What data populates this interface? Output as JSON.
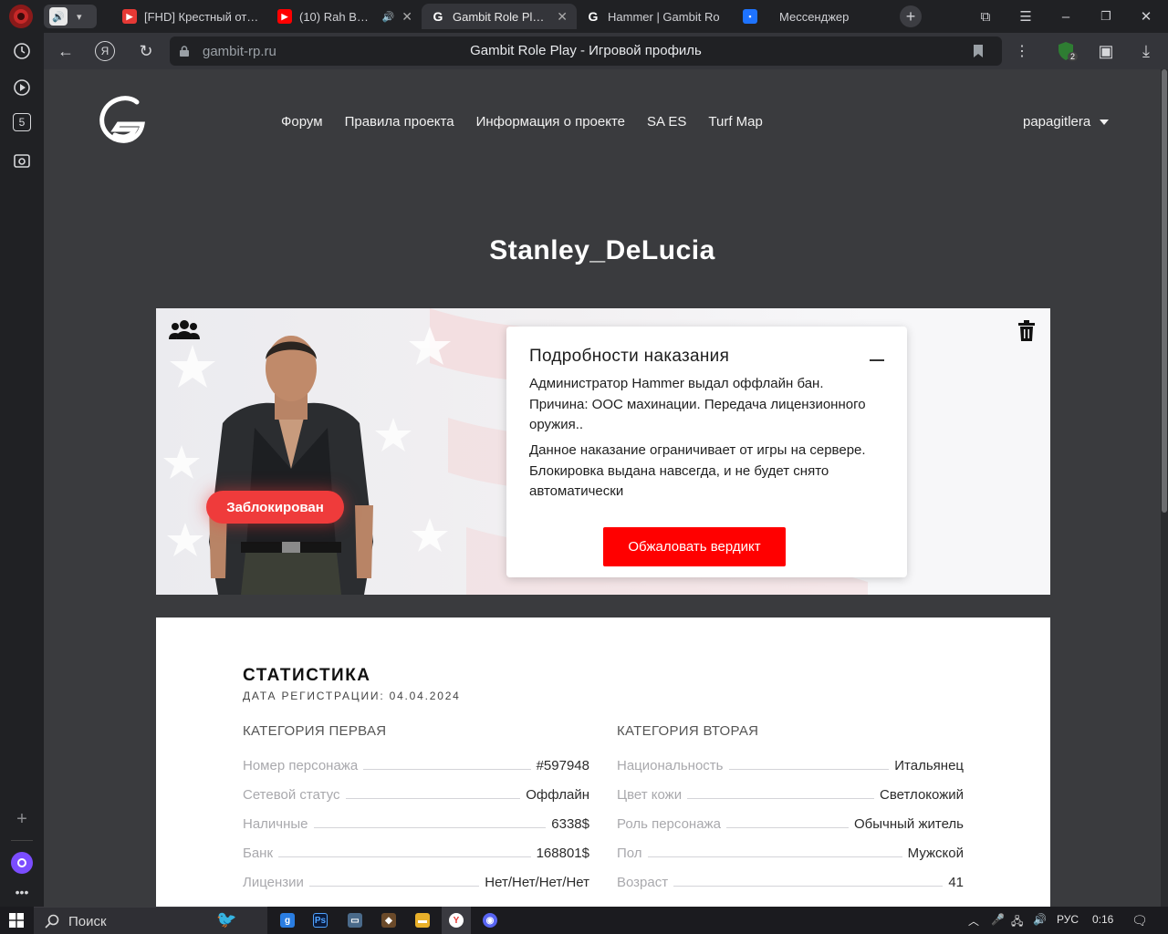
{
  "browser": {
    "tabs": [
      {
        "title": "[FHD] Крестный отец",
        "color": "#ff1744"
      },
      {
        "title": "(10) Rah Band -",
        "color": "#ff0000"
      },
      {
        "title": "Gambit Role Play -",
        "color": "#ffffff"
      },
      {
        "title": "Hammer | Gambit Ro",
        "color": "#ffffff"
      },
      {
        "title": "Мессенджер",
        "color": "#1e73ff"
      }
    ],
    "url_domain": "gambit-rp.ru",
    "page_title": "Gambit Role Play - Игровой профиль",
    "shield_count": "2",
    "sidebar_badge": "5"
  },
  "site": {
    "nav": [
      "Форум",
      "Правила проекта",
      "Информация о проекте",
      "SA ES",
      "Turf Map"
    ],
    "username": "papagitlera"
  },
  "profile": {
    "name": "Stanley_DeLucia",
    "status_badge": "Заблокирован",
    "punishment": {
      "title": "Подробности наказания",
      "text1": "Администратор Hammer выдал оффлайн бан. Причина: ООС махинации. Передача лицензионного оружия..",
      "text2": "Данное наказание ограничивает от игры на сервере. Блокировка выдана навсегда, и не будет снято автоматически",
      "appeal_button": "Обжаловать вердикт"
    }
  },
  "stats": {
    "title": "СТАТИСТИКА",
    "registration": "ДАТА РЕГИСТРАЦИИ: 04.04.2024",
    "category1": {
      "title": "КАТЕГОРИЯ ПЕРВАЯ",
      "rows": [
        {
          "label": "Номер персонажа",
          "value": "#597948"
        },
        {
          "label": "Сетевой статус",
          "value": "Оффлайн"
        },
        {
          "label": "Наличные",
          "value": "6338$"
        },
        {
          "label": "Банк",
          "value": "168801$"
        },
        {
          "label": "Лицензии",
          "value": "Нет/Нет/Нет/Нет"
        }
      ]
    },
    "category2": {
      "title": "КАТЕГОРИЯ ВТОРАЯ",
      "rows": [
        {
          "label": "Национальность",
          "value": "Итальянец"
        },
        {
          "label": "Цвет кожи",
          "value": "Светлокожий"
        },
        {
          "label": "Роль персонажа",
          "value": "Обычный житель"
        },
        {
          "label": "Пол",
          "value": "Мужской"
        },
        {
          "label": "Возраст",
          "value": "41"
        }
      ]
    }
  },
  "taskbar": {
    "search_label": "Поиск",
    "language": "РУС",
    "time": "0:16"
  }
}
